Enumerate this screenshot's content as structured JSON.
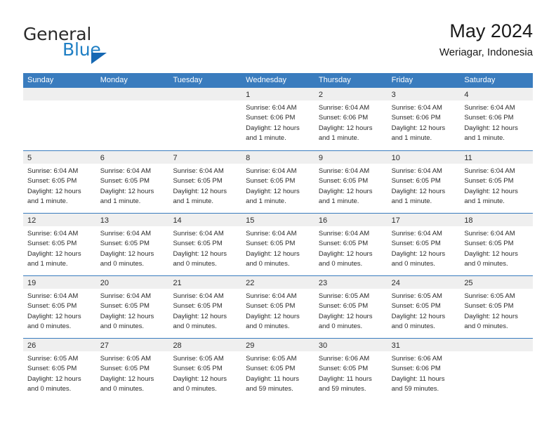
{
  "brand": {
    "name_part1": "General",
    "name_part2": "Blue",
    "mark": "triangle-flag-icon",
    "accent_color": "#1f7fc4"
  },
  "header": {
    "title": "May 2024",
    "subtitle": "Weriagar, Indonesia"
  },
  "theme": {
    "header_blue": "#3a7cbe",
    "day_band_gray": "#efefef",
    "text": "#2b2b2b"
  },
  "weekdays": [
    "Sunday",
    "Monday",
    "Tuesday",
    "Wednesday",
    "Thursday",
    "Friday",
    "Saturday"
  ],
  "weeks": [
    [
      {
        "day": "",
        "lines": []
      },
      {
        "day": "",
        "lines": []
      },
      {
        "day": "",
        "lines": []
      },
      {
        "day": "1",
        "lines": [
          "Sunrise: 6:04 AM",
          "Sunset: 6:06 PM",
          "Daylight: 12 hours",
          "and 1 minute."
        ]
      },
      {
        "day": "2",
        "lines": [
          "Sunrise: 6:04 AM",
          "Sunset: 6:06 PM",
          "Daylight: 12 hours",
          "and 1 minute."
        ]
      },
      {
        "day": "3",
        "lines": [
          "Sunrise: 6:04 AM",
          "Sunset: 6:06 PM",
          "Daylight: 12 hours",
          "and 1 minute."
        ]
      },
      {
        "day": "4",
        "lines": [
          "Sunrise: 6:04 AM",
          "Sunset: 6:06 PM",
          "Daylight: 12 hours",
          "and 1 minute."
        ]
      }
    ],
    [
      {
        "day": "5",
        "lines": [
          "Sunrise: 6:04 AM",
          "Sunset: 6:05 PM",
          "Daylight: 12 hours",
          "and 1 minute."
        ]
      },
      {
        "day": "6",
        "lines": [
          "Sunrise: 6:04 AM",
          "Sunset: 6:05 PM",
          "Daylight: 12 hours",
          "and 1 minute."
        ]
      },
      {
        "day": "7",
        "lines": [
          "Sunrise: 6:04 AM",
          "Sunset: 6:05 PM",
          "Daylight: 12 hours",
          "and 1 minute."
        ]
      },
      {
        "day": "8",
        "lines": [
          "Sunrise: 6:04 AM",
          "Sunset: 6:05 PM",
          "Daylight: 12 hours",
          "and 1 minute."
        ]
      },
      {
        "day": "9",
        "lines": [
          "Sunrise: 6:04 AM",
          "Sunset: 6:05 PM",
          "Daylight: 12 hours",
          "and 1 minute."
        ]
      },
      {
        "day": "10",
        "lines": [
          "Sunrise: 6:04 AM",
          "Sunset: 6:05 PM",
          "Daylight: 12 hours",
          "and 1 minute."
        ]
      },
      {
        "day": "11",
        "lines": [
          "Sunrise: 6:04 AM",
          "Sunset: 6:05 PM",
          "Daylight: 12 hours",
          "and 1 minute."
        ]
      }
    ],
    [
      {
        "day": "12",
        "lines": [
          "Sunrise: 6:04 AM",
          "Sunset: 6:05 PM",
          "Daylight: 12 hours",
          "and 1 minute."
        ]
      },
      {
        "day": "13",
        "lines": [
          "Sunrise: 6:04 AM",
          "Sunset: 6:05 PM",
          "Daylight: 12 hours",
          "and 0 minutes."
        ]
      },
      {
        "day": "14",
        "lines": [
          "Sunrise: 6:04 AM",
          "Sunset: 6:05 PM",
          "Daylight: 12 hours",
          "and 0 minutes."
        ]
      },
      {
        "day": "15",
        "lines": [
          "Sunrise: 6:04 AM",
          "Sunset: 6:05 PM",
          "Daylight: 12 hours",
          "and 0 minutes."
        ]
      },
      {
        "day": "16",
        "lines": [
          "Sunrise: 6:04 AM",
          "Sunset: 6:05 PM",
          "Daylight: 12 hours",
          "and 0 minutes."
        ]
      },
      {
        "day": "17",
        "lines": [
          "Sunrise: 6:04 AM",
          "Sunset: 6:05 PM",
          "Daylight: 12 hours",
          "and 0 minutes."
        ]
      },
      {
        "day": "18",
        "lines": [
          "Sunrise: 6:04 AM",
          "Sunset: 6:05 PM",
          "Daylight: 12 hours",
          "and 0 minutes."
        ]
      }
    ],
    [
      {
        "day": "19",
        "lines": [
          "Sunrise: 6:04 AM",
          "Sunset: 6:05 PM",
          "Daylight: 12 hours",
          "and 0 minutes."
        ]
      },
      {
        "day": "20",
        "lines": [
          "Sunrise: 6:04 AM",
          "Sunset: 6:05 PM",
          "Daylight: 12 hours",
          "and 0 minutes."
        ]
      },
      {
        "day": "21",
        "lines": [
          "Sunrise: 6:04 AM",
          "Sunset: 6:05 PM",
          "Daylight: 12 hours",
          "and 0 minutes."
        ]
      },
      {
        "day": "22",
        "lines": [
          "Sunrise: 6:04 AM",
          "Sunset: 6:05 PM",
          "Daylight: 12 hours",
          "and 0 minutes."
        ]
      },
      {
        "day": "23",
        "lines": [
          "Sunrise: 6:05 AM",
          "Sunset: 6:05 PM",
          "Daylight: 12 hours",
          "and 0 minutes."
        ]
      },
      {
        "day": "24",
        "lines": [
          "Sunrise: 6:05 AM",
          "Sunset: 6:05 PM",
          "Daylight: 12 hours",
          "and 0 minutes."
        ]
      },
      {
        "day": "25",
        "lines": [
          "Sunrise: 6:05 AM",
          "Sunset: 6:05 PM",
          "Daylight: 12 hours",
          "and 0 minutes."
        ]
      }
    ],
    [
      {
        "day": "26",
        "lines": [
          "Sunrise: 6:05 AM",
          "Sunset: 6:05 PM",
          "Daylight: 12 hours",
          "and 0 minutes."
        ]
      },
      {
        "day": "27",
        "lines": [
          "Sunrise: 6:05 AM",
          "Sunset: 6:05 PM",
          "Daylight: 12 hours",
          "and 0 minutes."
        ]
      },
      {
        "day": "28",
        "lines": [
          "Sunrise: 6:05 AM",
          "Sunset: 6:05 PM",
          "Daylight: 12 hours",
          "and 0 minutes."
        ]
      },
      {
        "day": "29",
        "lines": [
          "Sunrise: 6:05 AM",
          "Sunset: 6:05 PM",
          "Daylight: 11 hours",
          "and 59 minutes."
        ]
      },
      {
        "day": "30",
        "lines": [
          "Sunrise: 6:06 AM",
          "Sunset: 6:05 PM",
          "Daylight: 11 hours",
          "and 59 minutes."
        ]
      },
      {
        "day": "31",
        "lines": [
          "Sunrise: 6:06 AM",
          "Sunset: 6:06 PM",
          "Daylight: 11 hours",
          "and 59 minutes."
        ]
      },
      {
        "day": "",
        "lines": []
      }
    ]
  ]
}
